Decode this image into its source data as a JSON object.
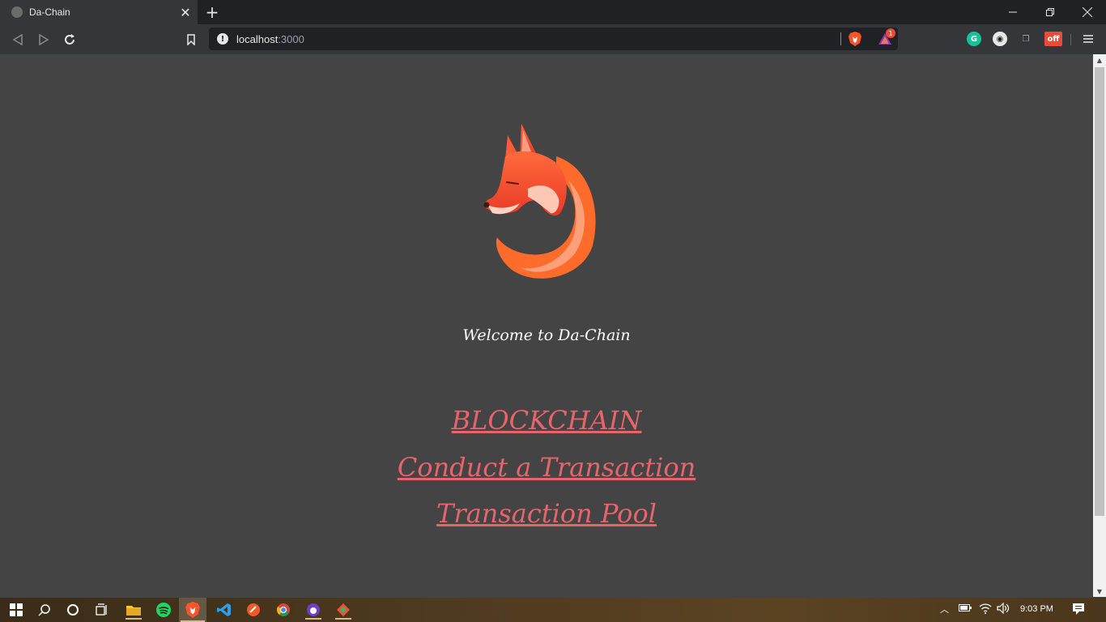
{
  "browser": {
    "tab_title": "Da-Chain",
    "close_tab_glyph": "✕",
    "new_tab_glyph": "+",
    "url_host": "localhost",
    "url_port": ":3000",
    "rewards_badge": "1",
    "extensions": [
      "grammarly-icon",
      "extension-icon",
      "extension-icon",
      "offline-extension-icon"
    ],
    "window_controls": [
      "minimize",
      "restore",
      "close"
    ]
  },
  "page": {
    "welcome_text": "Welcome to Da-Chain",
    "links": [
      {
        "label": "BLOCKCHAIN"
      },
      {
        "label": "Conduct a Transaction"
      },
      {
        "label": "Transaction Pool"
      }
    ],
    "link_color": "#e8646d",
    "background_color": "#444444"
  },
  "taskbar": {
    "time": "9:03 PM",
    "apps": [
      "windows-start-icon",
      "search-icon",
      "cortana-icon",
      "task-view-icon",
      "file-explorer-icon",
      "spotify-icon",
      "brave-icon",
      "vscode-icon",
      "app-icon",
      "chrome-icon",
      "github-desktop-icon",
      "git-icon"
    ]
  }
}
